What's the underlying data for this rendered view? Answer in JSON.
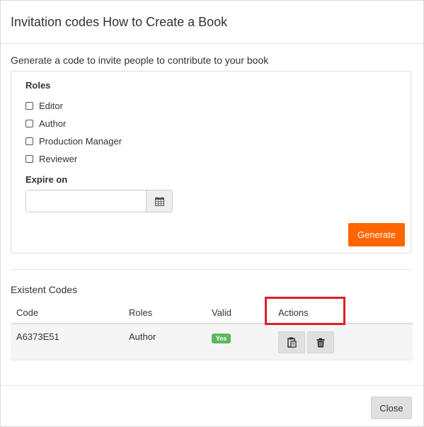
{
  "modal": {
    "title": "Invitation codes How to Create a Book",
    "intro": "Generate a code to invite people to contribute to your book"
  },
  "form": {
    "roles_label": "Roles",
    "roles": [
      {
        "label": "Editor",
        "checked": false
      },
      {
        "label": "Author",
        "checked": false
      },
      {
        "label": "Production Manager",
        "checked": false
      },
      {
        "label": "Reviewer",
        "checked": false
      }
    ],
    "expire_label": "Expire on",
    "expire_value": "",
    "calendar_icon": "calendar-icon",
    "generate_label": "Generate"
  },
  "codes": {
    "title": "Existent Codes",
    "columns": [
      "Code",
      "Roles",
      "Valid",
      "Actions"
    ],
    "rows": [
      {
        "code": "A6373E51",
        "roles": "Author",
        "valid": "Yes",
        "actions": [
          "clipboard-icon",
          "trash-icon"
        ]
      }
    ]
  },
  "footer": {
    "close_label": "Close"
  },
  "colors": {
    "accent": "#ff6600",
    "badge": "#5cb85c",
    "highlight": "#dd1f26"
  }
}
